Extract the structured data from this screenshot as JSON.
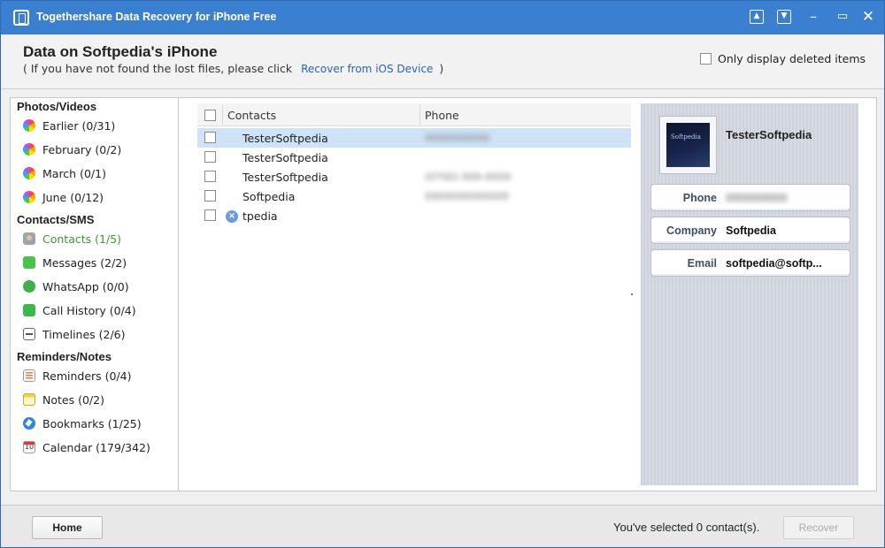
{
  "window": {
    "title": "Togethershare Data Recovery for iPhone Free",
    "controls": [
      "upload-icon",
      "download-icon",
      "minimize-icon",
      "maximize-icon",
      "close-icon"
    ]
  },
  "header": {
    "title": "Data on Softpedia's iPhone",
    "hint_prefix": "( If you have not found the lost files, please click",
    "hint_link": "Recover from iOS Device",
    "hint_suffix": ")",
    "only_deleted_label": "Only display deleted items",
    "only_deleted_checked": false
  },
  "sidebar": {
    "photos_title": "Photos/Videos",
    "contacts_title": "Contacts/SMS",
    "reminders_title": "Reminders/Notes",
    "items": [
      {
        "label": "Earlier (0/31)",
        "icon": "photos-icon"
      },
      {
        "label": "February (0/2)",
        "icon": "photos-icon"
      },
      {
        "label": "March (0/1)",
        "icon": "photos-icon"
      },
      {
        "label": "June (0/12)",
        "icon": "photos-icon"
      },
      {
        "label": "Contacts (1/5)",
        "icon": "contacts-icon",
        "active": true
      },
      {
        "label": "Messages (2/2)",
        "icon": "messages-icon"
      },
      {
        "label": "WhatsApp (0/0)",
        "icon": "whatsapp-icon"
      },
      {
        "label": "Call History (0/4)",
        "icon": "call-history-icon"
      },
      {
        "label": "Timelines (2/6)",
        "icon": "timelines-icon"
      },
      {
        "label": "Reminders (0/4)",
        "icon": "reminders-icon"
      },
      {
        "label": "Notes (0/2)",
        "icon": "notes-icon"
      },
      {
        "label": "Bookmarks (1/25)",
        "icon": "bookmarks-icon"
      },
      {
        "label": "Calendar (179/342)",
        "icon": "calendar-icon"
      }
    ],
    "calendar_icon_text": "10"
  },
  "table": {
    "columns": [
      "Contacts",
      "Phone"
    ],
    "rows": [
      {
        "name": "TesterSoftpedia",
        "phone": "0000000000",
        "selected": true,
        "deleted": false
      },
      {
        "name": "TesterSoftpedia",
        "phone": "",
        "selected": false,
        "deleted": false
      },
      {
        "name": "TesterSoftpedia",
        "phone": "(0700) 000-0000",
        "selected": false,
        "deleted": false
      },
      {
        "name": "Softpedia",
        "phone": "0000000000000",
        "selected": false,
        "deleted": false
      },
      {
        "name": "tpedia",
        "phone": "",
        "selected": false,
        "deleted": true
      }
    ],
    "deleted_icon_glyph": "×"
  },
  "details": {
    "name": "TesterSoftpedia",
    "avatar_caption": "Softpedia",
    "phone_label": "Phone",
    "phone_value": "0000000000",
    "company_label": "Company",
    "company_value": "Softpedia",
    "email_label": "Email",
    "email_value": "softpedia@softp..."
  },
  "footer": {
    "home_label": "Home",
    "status": "You've selected 0 contact(s).",
    "recover_label": "Recover"
  },
  "colors": {
    "titlebar": "#3b7fd0",
    "active_item": "#3c9a2f",
    "link": "#2a62b8",
    "selected_row": "#cfe3f8"
  }
}
